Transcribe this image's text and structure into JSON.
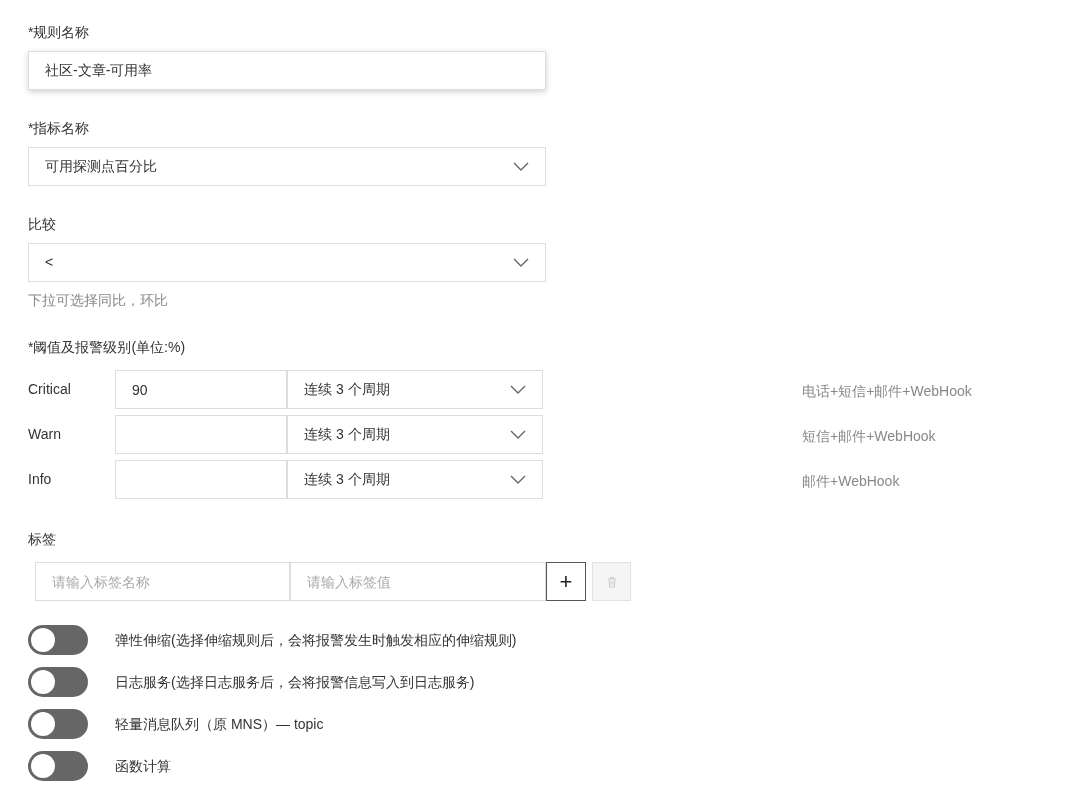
{
  "rule_name": {
    "label": "*规则名称",
    "value": "社区-文章-可用率"
  },
  "metric": {
    "label": "*指标名称",
    "value": "可用探测点百分比"
  },
  "compare": {
    "label": "比较",
    "value": "<",
    "hint": "下拉可选择同比，环比"
  },
  "thresholds": {
    "label": "*阈值及报警级别(单位:%)",
    "rows": [
      {
        "level": "Critical",
        "value": "90",
        "period": "连续 3 个周期",
        "notify": "电话+短信+邮件+WebHook"
      },
      {
        "level": "Warn",
        "period": "连续 3 个周期",
        "notify": "短信+邮件+WebHook"
      },
      {
        "level": "Info",
        "period": "连续 3 个周期",
        "notify": "邮件+WebHook"
      }
    ]
  },
  "tags": {
    "label": "标签",
    "name_placeholder": "请输入标签名称",
    "value_placeholder": "请输入标签值",
    "add_button": "+",
    "delete_disabled": true
  },
  "toggles": [
    {
      "label": "弹性伸缩(选择伸缩规则后，会将报警发生时触发相应的伸缩规则)",
      "on": false
    },
    {
      "label": "日志服务(选择日志服务后，会将报警信息写入到日志服务)",
      "on": false
    },
    {
      "label": "轻量消息队列（原 MNS）— topic",
      "on": false
    },
    {
      "label": "函数计算",
      "on": false
    }
  ]
}
